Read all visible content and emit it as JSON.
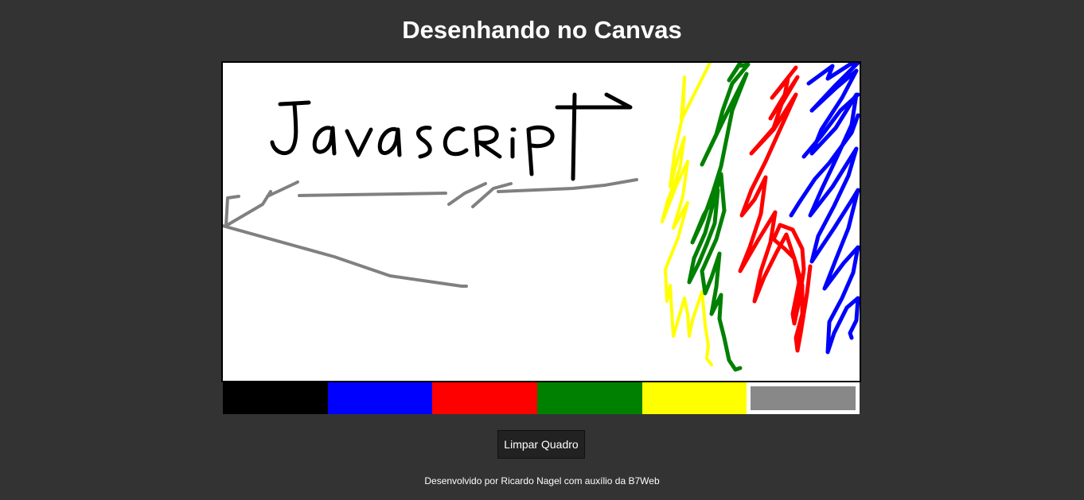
{
  "page": {
    "title": "Desenhando no Canvas",
    "background": "#333333"
  },
  "canvas": {
    "background": "#ffffff",
    "border_color": "#000000",
    "handwritten_text": "Javascript",
    "stroke_colors": [
      "#000000",
      "#808080",
      "#ffff00",
      "#008000",
      "#ff0000",
      "#0000ff"
    ]
  },
  "palette": {
    "colors": [
      {
        "name": "black",
        "hex": "#000000"
      },
      {
        "name": "blue",
        "hex": "#0000ff"
      },
      {
        "name": "red",
        "hex": "#ff0000"
      },
      {
        "name": "green",
        "hex": "#008000"
      },
      {
        "name": "yellow",
        "hex": "#ffff00"
      },
      {
        "name": "gray",
        "hex": "#888888"
      }
    ],
    "active": "gray"
  },
  "controls": {
    "clear_label": "Limpar Quadro"
  },
  "footer": {
    "text": "Desenvolvido por Ricardo Nagel com auxílio da B7Web"
  }
}
